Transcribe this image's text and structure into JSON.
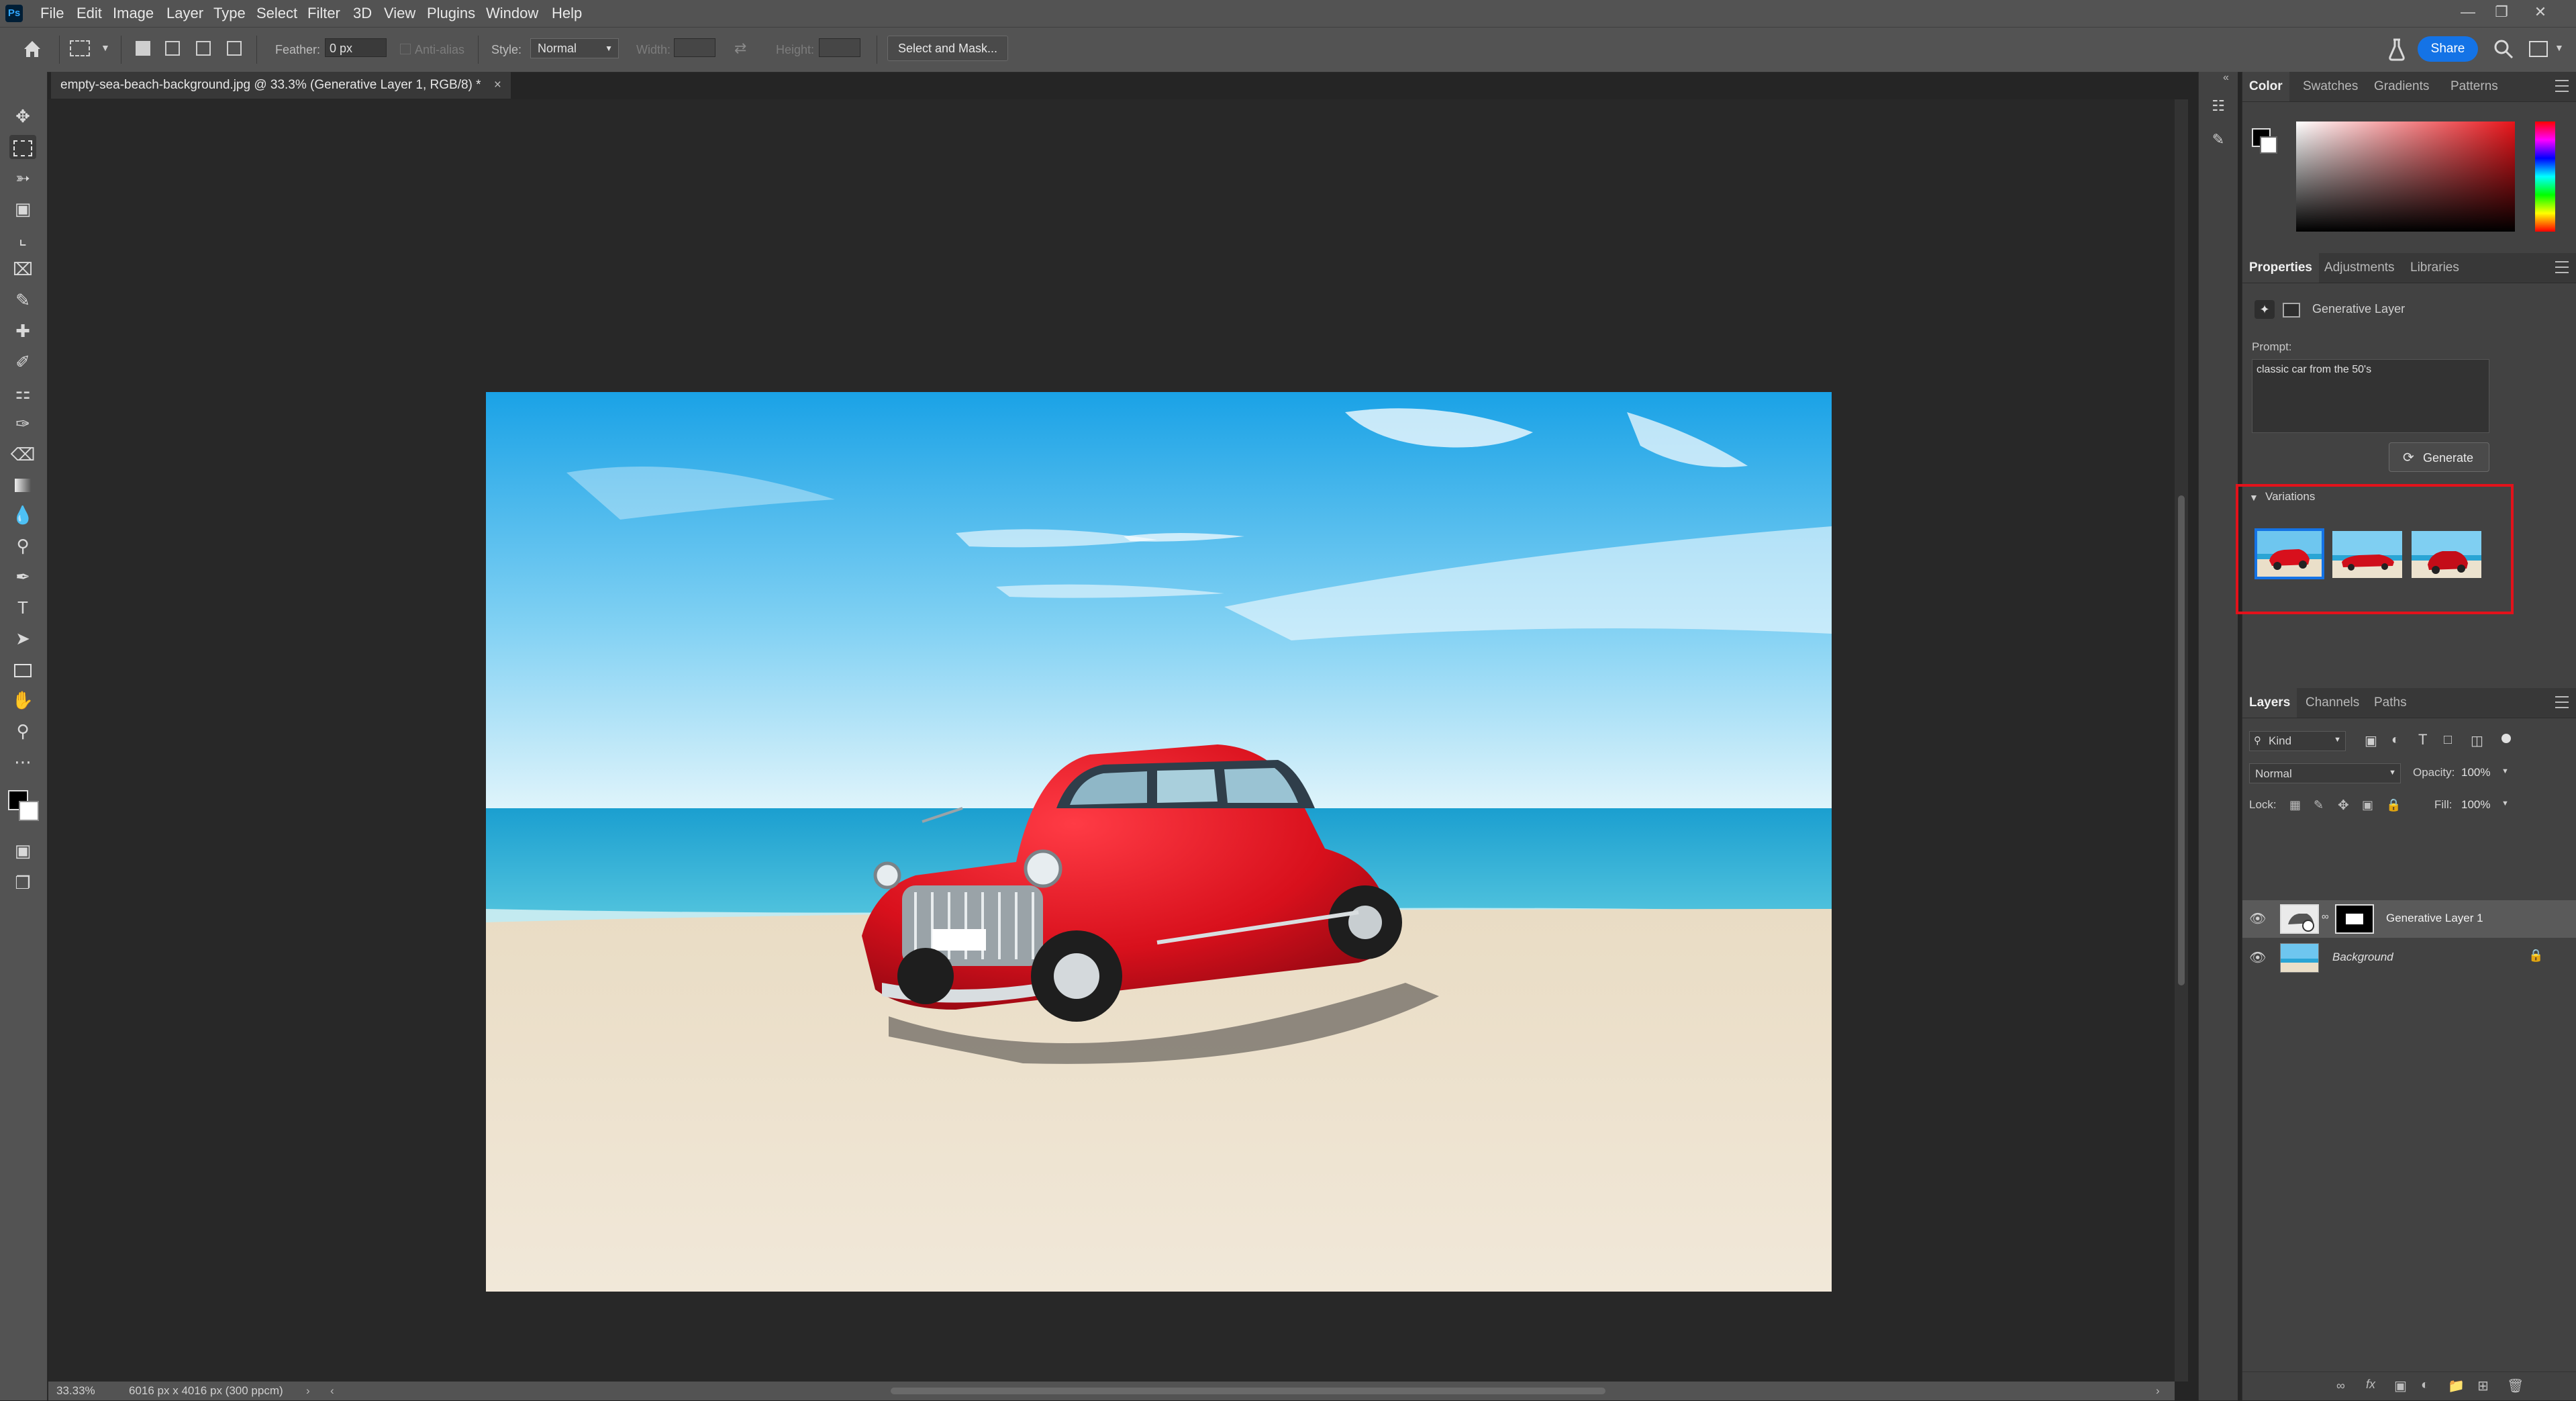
{
  "app": {
    "logo": "Ps",
    "menu": [
      "File",
      "Edit",
      "Image",
      "Layer",
      "Type",
      "Select",
      "Filter",
      "3D",
      "View",
      "Plugins",
      "Window",
      "Help"
    ],
    "share_label": "Share"
  },
  "options_bar": {
    "feather_label": "Feather:",
    "feather_value": "0 px",
    "anti_alias_label": "Anti-alias",
    "style_label": "Style:",
    "style_value": "Normal",
    "width_label": "Width:",
    "height_label": "Height:",
    "select_mask_label": "Select and Mask..."
  },
  "document": {
    "tab_title": "empty-sea-beach-background.jpg @ 33.3% (Generative Layer 1, RGB/8) *",
    "close_symbol": "×",
    "zoom": "33.33%",
    "dimensions": "6016 px x 4016 px (300 ppcm)"
  },
  "color_panel": {
    "tabs": [
      "Color",
      "Swatches",
      "Gradients",
      "Patterns"
    ],
    "active_tab": "Color",
    "hue_color": "#e8141a"
  },
  "properties_panel": {
    "tabs": [
      "Properties",
      "Adjustments",
      "Libraries"
    ],
    "layer_type": "Generative Layer",
    "prompt_label": "Prompt:",
    "prompt_value": "classic car from the 50's",
    "generate_label": "Generate",
    "variations_label": "Variations",
    "variations_count": 3,
    "selected_variation": 1
  },
  "layers_panel": {
    "tabs": [
      "Layers",
      "Channels",
      "Paths"
    ],
    "kind_label": "Kind",
    "blend_mode": "Normal",
    "opacity_label": "Opacity:",
    "opacity_value": "100%",
    "lock_label": "Lock:",
    "fill_label": "Fill:",
    "fill_value": "100%",
    "layers": [
      {
        "name": "Generative Layer 1",
        "selected": true,
        "locked": false
      },
      {
        "name": "Background",
        "selected": false,
        "locked": true
      }
    ]
  },
  "colors": {
    "accent": "#1473e6",
    "highlight_box": "#e3121b",
    "car_red": "#d8101c",
    "sky_top": "#22a8e8"
  },
  "icons": {
    "home": "home-icon",
    "search": "search-icon",
    "workspace": "workspace-icon",
    "flask": "flask-icon"
  }
}
